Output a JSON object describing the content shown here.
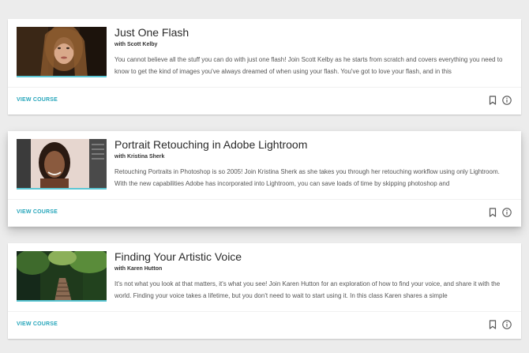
{
  "courses": [
    {
      "title": "Just One Flash",
      "author": "with Scott Kelby",
      "description": "You cannot believe all the stuff you can do with just one flash! Join Scott Kelby as he starts from scratch and covers everything you need to know to get the kind of images you've always dreamed of when using your flash. You've got to love your flash, and in this",
      "cta": "VIEW COURSE",
      "bookmark_icon": "bookmark-icon",
      "info_icon": "info-icon"
    },
    {
      "title": "Portrait Retouching in Adobe Lightroom",
      "author": "with Kristina Sherk",
      "description": "Retouching Portraits in Photoshop is so 2005! Join Kristina Sherk as she takes you through her retouching workflow using only Lightroom. With the new capabilities Adobe has incorporated into Lightroom, you can save loads of time by skipping photoshop and",
      "cta": "VIEW COURSE",
      "bookmark_icon": "bookmark-icon",
      "info_icon": "info-icon"
    },
    {
      "title": "Finding Your Artistic Voice",
      "author": "with Karen Hutton",
      "description": "It's not what you look at that matters, it's what you see! Join Karen Hutton for an exploration of how to find your voice, and share it with the world. Finding your voice takes a lifetime, but you don't need to wait to start using it. In this class Karen shares a simple",
      "cta": "VIEW COURSE",
      "bookmark_icon": "bookmark-icon",
      "info_icon": "info-icon"
    }
  ],
  "colors": {
    "accent": "#27a6bb",
    "thumb_underline": "#5bc6d4",
    "background": "#ececec",
    "card": "#ffffff"
  }
}
